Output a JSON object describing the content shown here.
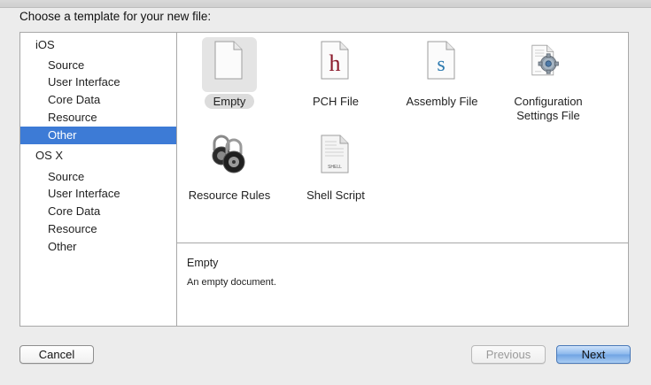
{
  "dialog": {
    "heading": "Choose a template for your new file:"
  },
  "sidebar": {
    "groups": [
      {
        "label": "iOS",
        "items": [
          "Source",
          "User Interface",
          "Core Data",
          "Resource",
          "Other"
        ]
      },
      {
        "label": "OS X",
        "items": [
          "Source",
          "User Interface",
          "Core Data",
          "Resource",
          "Other"
        ]
      }
    ],
    "selected": "iOS > Other"
  },
  "templates": [
    {
      "label": "Empty",
      "icon": "blank-document-icon",
      "selected": true
    },
    {
      "label": "PCH File",
      "icon": "header-file-icon",
      "glyph": "h",
      "glyph_color": "#8b1a2b",
      "selected": false
    },
    {
      "label": "Assembly File",
      "icon": "assembly-file-icon",
      "glyph": "s",
      "glyph_color": "#2f7bb0",
      "selected": false
    },
    {
      "label": "Configuration Settings File",
      "label_line1": "Configuration",
      "label_line2": "Settings File",
      "icon": "settings-gear-document-icon",
      "selected": false
    },
    {
      "label": "Resource Rules",
      "icon": "padlocks-icon",
      "selected": false
    },
    {
      "label": "Shell Script",
      "icon": "shell-script-document-icon",
      "icon_text": "SHELL",
      "selected": false
    }
  ],
  "description": {
    "title": "Empty",
    "body": "An empty document."
  },
  "buttons": {
    "cancel": "Cancel",
    "previous": "Previous",
    "next": "Next"
  },
  "colors": {
    "selection": "#3d7bd6",
    "primary_button": "#6fa3e3"
  }
}
